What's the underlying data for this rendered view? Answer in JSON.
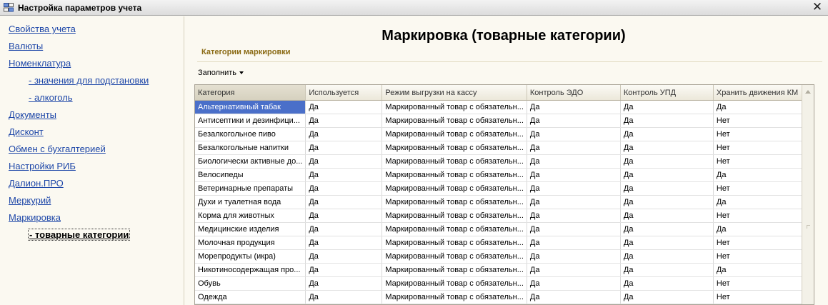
{
  "window": {
    "title": "Настройка параметров учета",
    "close_symbol": "✕"
  },
  "sidebar": {
    "items": [
      {
        "label": "Свойства учета"
      },
      {
        "label": "Валюты"
      },
      {
        "label": "Номенклатура"
      },
      {
        "label": "- значения для подстановки"
      },
      {
        "label": "- алкоголь"
      },
      {
        "label": "Документы"
      },
      {
        "label": "Дисконт"
      },
      {
        "label": "Обмен с бухгалтерией"
      },
      {
        "label": "Настройки РИБ"
      },
      {
        "label": "Далион.ПРО"
      },
      {
        "label": "Меркурий"
      },
      {
        "label": "Маркировка"
      },
      {
        "label": "- товарные категории"
      }
    ]
  },
  "main": {
    "page_title": "Маркировка (товарные категории)",
    "group_title": "Категории маркировки",
    "fill_button": "Заполнить"
  },
  "table": {
    "columns": [
      "Категория",
      "Используется",
      "Режим выгрузки на кассу",
      "Контроль ЭДО",
      "Контроль УПД",
      "Хранить движения КМ"
    ],
    "rows": [
      [
        "Альтернативный табак",
        "Да",
        "Маркированный товар с обязательн...",
        "Да",
        "Да",
        "Да"
      ],
      [
        "Антисептики и дезинфици...",
        "Да",
        "Маркированный товар с обязательн...",
        "Да",
        "Да",
        "Нет"
      ],
      [
        "Безалкогольное пиво",
        "Да",
        "Маркированный товар с обязательн...",
        "Да",
        "Да",
        "Нет"
      ],
      [
        "Безалкогольные напитки",
        "Да",
        "Маркированный товар с обязательн...",
        "Да",
        "Да",
        "Нет"
      ],
      [
        "Биологически активные до...",
        "Да",
        "Маркированный товар с обязательн...",
        "Да",
        "Да",
        "Нет"
      ],
      [
        "Велосипеды",
        "Да",
        "Маркированный товар с обязательн...",
        "Да",
        "Да",
        "Да"
      ],
      [
        "Ветеринарные препараты",
        "Да",
        "Маркированный товар с обязательн...",
        "Да",
        "Да",
        "Нет"
      ],
      [
        "Духи и туалетная вода",
        "Да",
        "Маркированный товар с обязательн...",
        "Да",
        "Да",
        "Да"
      ],
      [
        "Корма для животных",
        "Да",
        "Маркированный товар с обязательн...",
        "Да",
        "Да",
        "Нет"
      ],
      [
        "Медицинские изделия",
        "Да",
        "Маркированный товар с обязательн...",
        "Да",
        "Да",
        "Да"
      ],
      [
        "Молочная продукция",
        "Да",
        "Маркированный товар с обязательн...",
        "Да",
        "Да",
        "Нет"
      ],
      [
        "Морепродукты (икра)",
        "Да",
        "Маркированный товар с обязательн...",
        "Да",
        "Да",
        "Нет"
      ],
      [
        "Никотиносодержащая про...",
        "Да",
        "Маркированный товар с обязательн...",
        "Да",
        "Да",
        "Да"
      ],
      [
        "Обувь",
        "Да",
        "Маркированный товар с обязательн...",
        "Да",
        "Да",
        "Нет"
      ],
      [
        "Одежда",
        "Да",
        "Маркированный товар с обязательн...",
        "Да",
        "Да",
        "Нет"
      ]
    ]
  },
  "colors": {
    "link": "#1e47a8",
    "selection": "#4a6fc9",
    "group_title": "#8a6a14",
    "background": "#fbf9f1"
  }
}
